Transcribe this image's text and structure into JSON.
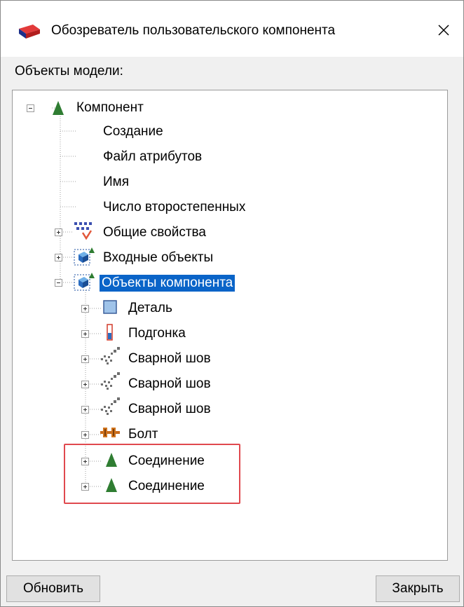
{
  "window": {
    "title": "Обозреватель пользовательского компонента",
    "close_glyph": "✕",
    "icon": "red-component-icon"
  },
  "section_label": "Объекты модели:",
  "tree": {
    "root": {
      "label": "Компонент",
      "icon": "green-cone-icon",
      "expanded": true
    },
    "root_children": [
      {
        "label": "Создание"
      },
      {
        "label": "Файл атрибутов"
      },
      {
        "label": "Имя"
      },
      {
        "label": "Число второстепенных"
      }
    ],
    "groups": [
      {
        "label": "Общие свойства",
        "icon": "properties-icon",
        "expanded": false
      },
      {
        "label": "Входные объекты",
        "icon": "input-objects-icon",
        "expanded": false
      },
      {
        "label": "Объекты компонента",
        "icon": "component-objects-icon",
        "expanded": true,
        "selected": true
      }
    ],
    "component_objects": [
      {
        "label": "Деталь",
        "icon": "part-icon"
      },
      {
        "label": "Подгонка",
        "icon": "fitting-icon"
      },
      {
        "label": "Сварной шов",
        "icon": "weld-icon"
      },
      {
        "label": "Сварной шов",
        "icon": "weld-icon"
      },
      {
        "label": "Сварной шов",
        "icon": "weld-icon"
      },
      {
        "label": "Болт",
        "icon": "bolt-icon"
      },
      {
        "label": "Соединение",
        "icon": "green-cone-icon",
        "highlighted": true
      },
      {
        "label": "Соединение",
        "icon": "green-cone-icon",
        "highlighted": true
      }
    ]
  },
  "buttons": {
    "refresh": "Обновить",
    "close": "Закрыть"
  },
  "colors": {
    "selection": "#0a64c8",
    "highlight": "#e0494e",
    "accent_green": "#2f7d32"
  }
}
